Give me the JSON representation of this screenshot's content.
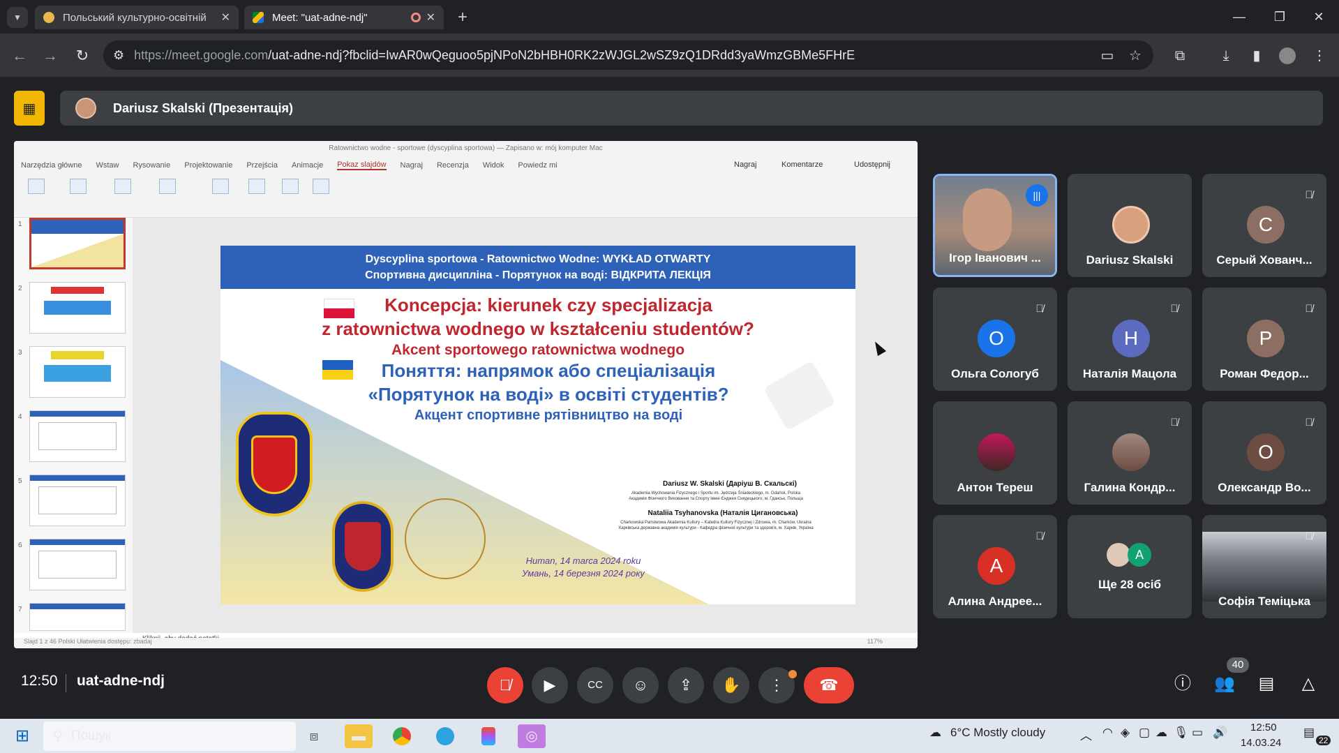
{
  "browser": {
    "tabs": [
      {
        "title": "Польський культурно-освітній",
        "active": false
      },
      {
        "title": "Meet: \"uat-adne-ndj\"",
        "active": true
      }
    ],
    "url_host": "https://meet.google.com",
    "url_path": "/uat-adne-ndj?fbclid=IwAR0wQeguoo5pjNPoN2bHBH0RK2zWJGL2wSZ9zQ1DRdd3yaWmzGBMe5FHrE"
  },
  "presenter": {
    "label": "Dariusz Skalski (Презентація)"
  },
  "powerpoint": {
    "window_title": "Ratownictwo wodne - sportowe (dyscyplina sportowa) — Zapisano w: mój komputer Mac",
    "ribbon_tabs": [
      "Narzędzia główne",
      "Wstaw",
      "Rysowanie",
      "Projektowanie",
      "Przejścia",
      "Animacje",
      "Pokaz slajdów",
      "Nagraj",
      "Recenzja",
      "Widok",
      "Powiedz mi"
    ],
    "ribbon_right": [
      "Nagraj",
      "Komentarze",
      "Udostępnij"
    ],
    "notes_placeholder": "Kliknij, aby dodać notatki",
    "status": "Slajd 1 z 46   Polski   Ułatwienia dostępu: zbadaj",
    "zoom": "117%",
    "thumb_numbers": [
      "1",
      "2",
      "3",
      "4",
      "5",
      "6",
      "7"
    ]
  },
  "slide": {
    "banner_line1": "Dyscyplina sportowa - Ratownictwo Wodne: WYKŁAD OTWARTY",
    "banner_line2": "Спортивна дисципліна - Порятунок на воді: ВІДКРИТА ЛЕКЦІЯ",
    "pl_title1": "Koncepcja: kierunek czy specjalizacja",
    "pl_title2": "z ratownictwa wodnego w kształceniu studentów?",
    "pl_sub": "Akcent sportowego ratownictwa wodnego",
    "ua_title1": "Поняття: напрямок або спеціалізація",
    "ua_title2": "«Порятунок на воді» в освіті студентів?",
    "ua_sub": "Акцент спортивне рятівництво на воді",
    "author1": "Dariusz W. Skalski (Даріуш В. Скальскі)",
    "author1_aff": "Akademia Wychowania Fizycznego i Sportu im. Jędrzeja Śniadeckiego, m. Gdańsk, Polska",
    "author1_aff2": "Академія Фізичного Виховання та Спорту імені Єнджея Снядецького, м. Гданськ, Польща",
    "author2": "Nataliia Tsyhanovska (Наталія Циганoвська)",
    "author2_aff": "Charkowska Państwowa Akademia Kultury – Katedra Kultury Fizycznej i Zdrowia, m. Charków, Ukraina",
    "author2_aff2": "Харківська державна академія культури - Кафедра фізичної культури та здоров'я, м. Харків, Україна",
    "place_pl": "Human, 14 marca 2024 roku",
    "place_ua": "Умань, 14 березня 2024 року"
  },
  "participants": [
    {
      "name": "Ігор Іванович ...",
      "type": "video",
      "speaking": true
    },
    {
      "name": "Dariusz Skalski",
      "type": "photo",
      "muted": false
    },
    {
      "name": "Серый Хованч...",
      "initial": "С",
      "color": "#8d6e63",
      "muted": true
    },
    {
      "name": "Ольга Сологуб",
      "initial": "О",
      "color": "#1a73e8",
      "muted": true
    },
    {
      "name": "Наталія Мацола",
      "initial": "Н",
      "color": "#5c6bc0",
      "muted": true
    },
    {
      "name": "Роман Федор...",
      "initial": "Р",
      "color": "#8d6e63",
      "muted": true
    },
    {
      "name": "Антон Тереш",
      "type": "photo",
      "muted": false
    },
    {
      "name": "Галина Кондр...",
      "type": "photo",
      "muted": true
    },
    {
      "name": "Олександр Во...",
      "initial": "О",
      "color": "#6d4c41",
      "muted": true
    },
    {
      "name": "Алина Андрее...",
      "initial": "А",
      "color": "#d93025",
      "muted": true
    },
    {
      "name": "Ще 28 осіб",
      "type": "more"
    },
    {
      "name": "Софія Теміцька",
      "type": "video",
      "muted": true
    }
  ],
  "meeting": {
    "time": "12:50",
    "code": "uat-adne-ndj",
    "participant_count": "40"
  },
  "taskbar": {
    "search": "Пошук",
    "weather": "6°C  Mostly cloudy",
    "time": "12:50",
    "date": "14.03.24",
    "notif": "22"
  }
}
